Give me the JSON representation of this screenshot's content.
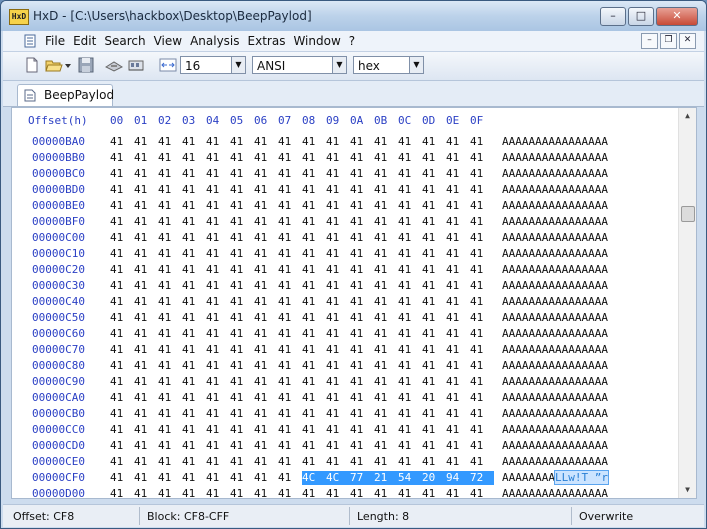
{
  "window": {
    "title": "HxD - [C:\\Users\\hackbox\\Desktop\\BeepPaylod]",
    "app_icon_text": "HxD",
    "controls": {
      "minimize": "–",
      "maximize": "□",
      "close": "✕"
    }
  },
  "menubar": {
    "items": [
      "File",
      "Edit",
      "Search",
      "View",
      "Analysis",
      "Extras",
      "Window",
      "?"
    ],
    "mdi_controls": {
      "minimize": "–",
      "restore": "❐",
      "close": "✕"
    }
  },
  "toolbar": {
    "bytes_per_row": "16",
    "charset": "ANSI",
    "display_mode": "hex"
  },
  "tabs": [
    {
      "label": "BeepPaylod"
    }
  ],
  "editor": {
    "offset_header": "Offset(h)",
    "column_headers": [
      "00",
      "01",
      "02",
      "03",
      "04",
      "05",
      "06",
      "07",
      "08",
      "09",
      "0A",
      "0B",
      "0C",
      "0D",
      "0E",
      "0F"
    ],
    "rows": [
      {
        "offset": "00000BA0",
        "bytes": [
          "41",
          "41",
          "41",
          "41",
          "41",
          "41",
          "41",
          "41",
          "41",
          "41",
          "41",
          "41",
          "41",
          "41",
          "41",
          "41"
        ],
        "ascii": "AAAAAAAAAAAAAAAA"
      },
      {
        "offset": "00000BB0",
        "bytes": [
          "41",
          "41",
          "41",
          "41",
          "41",
          "41",
          "41",
          "41",
          "41",
          "41",
          "41",
          "41",
          "41",
          "41",
          "41",
          "41"
        ],
        "ascii": "AAAAAAAAAAAAAAAA"
      },
      {
        "offset": "00000BC0",
        "bytes": [
          "41",
          "41",
          "41",
          "41",
          "41",
          "41",
          "41",
          "41",
          "41",
          "41",
          "41",
          "41",
          "41",
          "41",
          "41",
          "41"
        ],
        "ascii": "AAAAAAAAAAAAAAAA"
      },
      {
        "offset": "00000BD0",
        "bytes": [
          "41",
          "41",
          "41",
          "41",
          "41",
          "41",
          "41",
          "41",
          "41",
          "41",
          "41",
          "41",
          "41",
          "41",
          "41",
          "41"
        ],
        "ascii": "AAAAAAAAAAAAAAAA"
      },
      {
        "offset": "00000BE0",
        "bytes": [
          "41",
          "41",
          "41",
          "41",
          "41",
          "41",
          "41",
          "41",
          "41",
          "41",
          "41",
          "41",
          "41",
          "41",
          "41",
          "41"
        ],
        "ascii": "AAAAAAAAAAAAAAAA"
      },
      {
        "offset": "00000BF0",
        "bytes": [
          "41",
          "41",
          "41",
          "41",
          "41",
          "41",
          "41",
          "41",
          "41",
          "41",
          "41",
          "41",
          "41",
          "41",
          "41",
          "41"
        ],
        "ascii": "AAAAAAAAAAAAAAAA"
      },
      {
        "offset": "00000C00",
        "bytes": [
          "41",
          "41",
          "41",
          "41",
          "41",
          "41",
          "41",
          "41",
          "41",
          "41",
          "41",
          "41",
          "41",
          "41",
          "41",
          "41"
        ],
        "ascii": "AAAAAAAAAAAAAAAA"
      },
      {
        "offset": "00000C10",
        "bytes": [
          "41",
          "41",
          "41",
          "41",
          "41",
          "41",
          "41",
          "41",
          "41",
          "41",
          "41",
          "41",
          "41",
          "41",
          "41",
          "41"
        ],
        "ascii": "AAAAAAAAAAAAAAAA"
      },
      {
        "offset": "00000C20",
        "bytes": [
          "41",
          "41",
          "41",
          "41",
          "41",
          "41",
          "41",
          "41",
          "41",
          "41",
          "41",
          "41",
          "41",
          "41",
          "41",
          "41"
        ],
        "ascii": "AAAAAAAAAAAAAAAA"
      },
      {
        "offset": "00000C30",
        "bytes": [
          "41",
          "41",
          "41",
          "41",
          "41",
          "41",
          "41",
          "41",
          "41",
          "41",
          "41",
          "41",
          "41",
          "41",
          "41",
          "41"
        ],
        "ascii": "AAAAAAAAAAAAAAAA"
      },
      {
        "offset": "00000C40",
        "bytes": [
          "41",
          "41",
          "41",
          "41",
          "41",
          "41",
          "41",
          "41",
          "41",
          "41",
          "41",
          "41",
          "41",
          "41",
          "41",
          "41"
        ],
        "ascii": "AAAAAAAAAAAAAAAA"
      },
      {
        "offset": "00000C50",
        "bytes": [
          "41",
          "41",
          "41",
          "41",
          "41",
          "41",
          "41",
          "41",
          "41",
          "41",
          "41",
          "41",
          "41",
          "41",
          "41",
          "41"
        ],
        "ascii": "AAAAAAAAAAAAAAAA"
      },
      {
        "offset": "00000C60",
        "bytes": [
          "41",
          "41",
          "41",
          "41",
          "41",
          "41",
          "41",
          "41",
          "41",
          "41",
          "41",
          "41",
          "41",
          "41",
          "41",
          "41"
        ],
        "ascii": "AAAAAAAAAAAAAAAA"
      },
      {
        "offset": "00000C70",
        "bytes": [
          "41",
          "41",
          "41",
          "41",
          "41",
          "41",
          "41",
          "41",
          "41",
          "41",
          "41",
          "41",
          "41",
          "41",
          "41",
          "41"
        ],
        "ascii": "AAAAAAAAAAAAAAAA"
      },
      {
        "offset": "00000C80",
        "bytes": [
          "41",
          "41",
          "41",
          "41",
          "41",
          "41",
          "41",
          "41",
          "41",
          "41",
          "41",
          "41",
          "41",
          "41",
          "41",
          "41"
        ],
        "ascii": "AAAAAAAAAAAAAAAA"
      },
      {
        "offset": "00000C90",
        "bytes": [
          "41",
          "41",
          "41",
          "41",
          "41",
          "41",
          "41",
          "41",
          "41",
          "41",
          "41",
          "41",
          "41",
          "41",
          "41",
          "41"
        ],
        "ascii": "AAAAAAAAAAAAAAAA"
      },
      {
        "offset": "00000CA0",
        "bytes": [
          "41",
          "41",
          "41",
          "41",
          "41",
          "41",
          "41",
          "41",
          "41",
          "41",
          "41",
          "41",
          "41",
          "41",
          "41",
          "41"
        ],
        "ascii": "AAAAAAAAAAAAAAAA"
      },
      {
        "offset": "00000CB0",
        "bytes": [
          "41",
          "41",
          "41",
          "41",
          "41",
          "41",
          "41",
          "41",
          "41",
          "41",
          "41",
          "41",
          "41",
          "41",
          "41",
          "41"
        ],
        "ascii": "AAAAAAAAAAAAAAAA"
      },
      {
        "offset": "00000CC0",
        "bytes": [
          "41",
          "41",
          "41",
          "41",
          "41",
          "41",
          "41",
          "41",
          "41",
          "41",
          "41",
          "41",
          "41",
          "41",
          "41",
          "41"
        ],
        "ascii": "AAAAAAAAAAAAAAAA"
      },
      {
        "offset": "00000CD0",
        "bytes": [
          "41",
          "41",
          "41",
          "41",
          "41",
          "41",
          "41",
          "41",
          "41",
          "41",
          "41",
          "41",
          "41",
          "41",
          "41",
          "41"
        ],
        "ascii": "AAAAAAAAAAAAAAAA"
      },
      {
        "offset": "00000CE0",
        "bytes": [
          "41",
          "41",
          "41",
          "41",
          "41",
          "41",
          "41",
          "41",
          "41",
          "41",
          "41",
          "41",
          "41",
          "41",
          "41",
          "41"
        ],
        "ascii": "AAAAAAAAAAAAAAAA"
      },
      {
        "offset": "00000CF0",
        "bytes": [
          "41",
          "41",
          "41",
          "41",
          "41",
          "41",
          "41",
          "41",
          "4C",
          "4C",
          "77",
          "21",
          "54",
          "20",
          "94",
          "72"
        ],
        "ascii": "AAAAAAAA",
        "ascii_selected": "LLw!T ”r",
        "selected_from": 8
      },
      {
        "offset": "00000D00",
        "bytes": [
          "41",
          "41",
          "41",
          "41",
          "41",
          "41",
          "41",
          "41",
          "41",
          "41",
          "41",
          "41",
          "41",
          "41",
          "41",
          "41"
        ],
        "ascii": "AAAAAAAAAAAAAAAA"
      }
    ]
  },
  "statusbar": {
    "offset": "Offset: CF8",
    "block": "Block: CF8-CFF",
    "length": "Length: 8",
    "mode": "Overwrite"
  },
  "colors": {
    "offset_text": "#2a3fc4",
    "selection": "#3399ff"
  }
}
